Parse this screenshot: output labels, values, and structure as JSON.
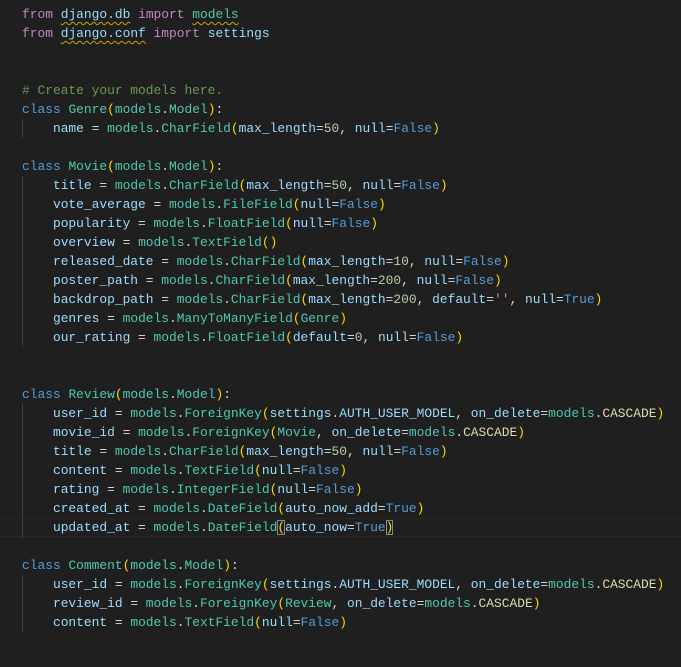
{
  "editor": {
    "language": "python",
    "current_line": 27,
    "colors": {
      "background": "#1f1f1f",
      "keyword": "#c586c0",
      "storage": "#569cd6",
      "class": "#4ec9b0",
      "variable": "#9cdcfe",
      "bracket": "#ffd700",
      "number": "#b5cea8",
      "string": "#ce9178",
      "comment": "#6a9955"
    },
    "lines": [
      [
        [
          "from",
          "kw"
        ],
        [
          " ",
          "p"
        ],
        [
          "django.db",
          "var warn"
        ],
        [
          " ",
          "p"
        ],
        [
          "import",
          "kw"
        ],
        [
          " ",
          "p"
        ],
        [
          "models",
          "mod warn"
        ]
      ],
      [
        [
          "from",
          "kw"
        ],
        [
          " ",
          "p"
        ],
        [
          "django.conf",
          "var warn"
        ],
        [
          " ",
          "p"
        ],
        [
          "import",
          "kw"
        ],
        [
          " ",
          "p"
        ],
        [
          "settings",
          "var"
        ]
      ],
      [],
      [],
      [
        [
          "# Create your models here.",
          "com"
        ]
      ],
      [
        [
          "class",
          "st"
        ],
        [
          " ",
          "p"
        ],
        [
          "Genre",
          "cls"
        ],
        [
          "(",
          "br"
        ],
        [
          "models",
          "mod"
        ],
        [
          ".",
          "p"
        ],
        [
          "Model",
          "cls"
        ],
        [
          ")",
          "br"
        ],
        [
          ":",
          "p"
        ]
      ],
      [
        [
          "    ",
          "p"
        ],
        [
          "name",
          "var"
        ],
        [
          " = ",
          "p"
        ],
        [
          "models",
          "mod"
        ],
        [
          ".",
          "p"
        ],
        [
          "CharField",
          "cls"
        ],
        [
          "(",
          "br"
        ],
        [
          "max_length",
          "var"
        ],
        [
          "=",
          "p"
        ],
        [
          "50",
          "num"
        ],
        [
          ", ",
          "p"
        ],
        [
          "null",
          "var"
        ],
        [
          "=",
          "p"
        ],
        [
          "False",
          "st"
        ],
        [
          ")",
          "br"
        ]
      ],
      [],
      [
        [
          "class",
          "st"
        ],
        [
          " ",
          "p"
        ],
        [
          "Movie",
          "cls"
        ],
        [
          "(",
          "br"
        ],
        [
          "models",
          "mod"
        ],
        [
          ".",
          "p"
        ],
        [
          "Model",
          "cls"
        ],
        [
          ")",
          "br"
        ],
        [
          ":",
          "p"
        ]
      ],
      [
        [
          "    ",
          "p"
        ],
        [
          "title",
          "var"
        ],
        [
          " = ",
          "p"
        ],
        [
          "models",
          "mod"
        ],
        [
          ".",
          "p"
        ],
        [
          "CharField",
          "cls"
        ],
        [
          "(",
          "br"
        ],
        [
          "max_length",
          "var"
        ],
        [
          "=",
          "p"
        ],
        [
          "50",
          "num"
        ],
        [
          ", ",
          "p"
        ],
        [
          "null",
          "var"
        ],
        [
          "=",
          "p"
        ],
        [
          "False",
          "st"
        ],
        [
          ")",
          "br"
        ]
      ],
      [
        [
          "    ",
          "p"
        ],
        [
          "vote_average",
          "var"
        ],
        [
          " = ",
          "p"
        ],
        [
          "models",
          "mod"
        ],
        [
          ".",
          "p"
        ],
        [
          "FileField",
          "cls"
        ],
        [
          "(",
          "br"
        ],
        [
          "null",
          "var"
        ],
        [
          "=",
          "p"
        ],
        [
          "False",
          "st"
        ],
        [
          ")",
          "br"
        ]
      ],
      [
        [
          "    ",
          "p"
        ],
        [
          "popularity",
          "var"
        ],
        [
          " = ",
          "p"
        ],
        [
          "models",
          "mod"
        ],
        [
          ".",
          "p"
        ],
        [
          "FloatField",
          "cls"
        ],
        [
          "(",
          "br"
        ],
        [
          "null",
          "var"
        ],
        [
          "=",
          "p"
        ],
        [
          "False",
          "st"
        ],
        [
          ")",
          "br"
        ]
      ],
      [
        [
          "    ",
          "p"
        ],
        [
          "overview",
          "var"
        ],
        [
          " = ",
          "p"
        ],
        [
          "models",
          "mod"
        ],
        [
          ".",
          "p"
        ],
        [
          "TextField",
          "cls"
        ],
        [
          "()",
          "br"
        ]
      ],
      [
        [
          "    ",
          "p"
        ],
        [
          "released_date",
          "var"
        ],
        [
          " = ",
          "p"
        ],
        [
          "models",
          "mod"
        ],
        [
          ".",
          "p"
        ],
        [
          "CharField",
          "cls"
        ],
        [
          "(",
          "br"
        ],
        [
          "max_length",
          "var"
        ],
        [
          "=",
          "p"
        ],
        [
          "10",
          "num"
        ],
        [
          ", ",
          "p"
        ],
        [
          "null",
          "var"
        ],
        [
          "=",
          "p"
        ],
        [
          "False",
          "st"
        ],
        [
          ")",
          "br"
        ]
      ],
      [
        [
          "    ",
          "p"
        ],
        [
          "poster_path",
          "var"
        ],
        [
          " = ",
          "p"
        ],
        [
          "models",
          "mod"
        ],
        [
          ".",
          "p"
        ],
        [
          "CharField",
          "cls"
        ],
        [
          "(",
          "br"
        ],
        [
          "max_length",
          "var"
        ],
        [
          "=",
          "p"
        ],
        [
          "200",
          "num"
        ],
        [
          ", ",
          "p"
        ],
        [
          "null",
          "var"
        ],
        [
          "=",
          "p"
        ],
        [
          "False",
          "st"
        ],
        [
          ")",
          "br"
        ]
      ],
      [
        [
          "    ",
          "p"
        ],
        [
          "backdrop_path",
          "var"
        ],
        [
          " = ",
          "p"
        ],
        [
          "models",
          "mod"
        ],
        [
          ".",
          "p"
        ],
        [
          "CharField",
          "cls"
        ],
        [
          "(",
          "br"
        ],
        [
          "max_length",
          "var"
        ],
        [
          "=",
          "p"
        ],
        [
          "200",
          "num"
        ],
        [
          ", ",
          "p"
        ],
        [
          "default",
          "var"
        ],
        [
          "=",
          "p"
        ],
        [
          "''",
          "str"
        ],
        [
          ", ",
          "p"
        ],
        [
          "null",
          "var"
        ],
        [
          "=",
          "p"
        ],
        [
          "True",
          "st"
        ],
        [
          ")",
          "br"
        ]
      ],
      [
        [
          "    ",
          "p"
        ],
        [
          "genres",
          "var"
        ],
        [
          " = ",
          "p"
        ],
        [
          "models",
          "mod"
        ],
        [
          ".",
          "p"
        ],
        [
          "ManyToManyField",
          "cls"
        ],
        [
          "(",
          "br"
        ],
        [
          "Genre",
          "cls"
        ],
        [
          ")",
          "br"
        ]
      ],
      [
        [
          "    ",
          "p"
        ],
        [
          "our_rating",
          "var"
        ],
        [
          " = ",
          "p"
        ],
        [
          "models",
          "mod"
        ],
        [
          ".",
          "p"
        ],
        [
          "FloatField",
          "cls"
        ],
        [
          "(",
          "br"
        ],
        [
          "default",
          "var"
        ],
        [
          "=",
          "p"
        ],
        [
          "0",
          "num"
        ],
        [
          ", ",
          "p"
        ],
        [
          "null",
          "var"
        ],
        [
          "=",
          "p"
        ],
        [
          "False",
          "st"
        ],
        [
          ")",
          "br"
        ]
      ],
      [],
      [],
      [
        [
          "class",
          "st"
        ],
        [
          " ",
          "p"
        ],
        [
          "Review",
          "cls"
        ],
        [
          "(",
          "br"
        ],
        [
          "models",
          "mod"
        ],
        [
          ".",
          "p"
        ],
        [
          "Model",
          "cls"
        ],
        [
          ")",
          "br"
        ],
        [
          ":",
          "p"
        ]
      ],
      [
        [
          "    ",
          "p"
        ],
        [
          "user_id",
          "var"
        ],
        [
          " = ",
          "p"
        ],
        [
          "models",
          "mod"
        ],
        [
          ".",
          "p"
        ],
        [
          "ForeignKey",
          "cls"
        ],
        [
          "(",
          "br"
        ],
        [
          "settings",
          "var"
        ],
        [
          ".",
          "p"
        ],
        [
          "AUTH_USER_MODEL",
          "var"
        ],
        [
          ", ",
          "p"
        ],
        [
          "on_delete",
          "var"
        ],
        [
          "=",
          "p"
        ],
        [
          "models",
          "mod"
        ],
        [
          ".",
          "p"
        ],
        [
          "CASCADE",
          "const"
        ],
        [
          ")",
          "br"
        ]
      ],
      [
        [
          "    ",
          "p"
        ],
        [
          "movie_id",
          "var"
        ],
        [
          " = ",
          "p"
        ],
        [
          "models",
          "mod"
        ],
        [
          ".",
          "p"
        ],
        [
          "ForeignKey",
          "cls"
        ],
        [
          "(",
          "br"
        ],
        [
          "Movie",
          "cls"
        ],
        [
          ", ",
          "p"
        ],
        [
          "on_delete",
          "var"
        ],
        [
          "=",
          "p"
        ],
        [
          "models",
          "mod"
        ],
        [
          ".",
          "p"
        ],
        [
          "CASCADE",
          "const"
        ],
        [
          ")",
          "br"
        ]
      ],
      [
        [
          "    ",
          "p"
        ],
        [
          "title",
          "var"
        ],
        [
          " = ",
          "p"
        ],
        [
          "models",
          "mod"
        ],
        [
          ".",
          "p"
        ],
        [
          "CharField",
          "cls"
        ],
        [
          "(",
          "br"
        ],
        [
          "max_length",
          "var"
        ],
        [
          "=",
          "p"
        ],
        [
          "50",
          "num"
        ],
        [
          ", ",
          "p"
        ],
        [
          "null",
          "var"
        ],
        [
          "=",
          "p"
        ],
        [
          "False",
          "st"
        ],
        [
          ")",
          "br"
        ]
      ],
      [
        [
          "    ",
          "p"
        ],
        [
          "content",
          "var"
        ],
        [
          " = ",
          "p"
        ],
        [
          "models",
          "mod"
        ],
        [
          ".",
          "p"
        ],
        [
          "TextField",
          "cls"
        ],
        [
          "(",
          "br"
        ],
        [
          "null",
          "var"
        ],
        [
          "=",
          "p"
        ],
        [
          "False",
          "st"
        ],
        [
          ")",
          "br"
        ]
      ],
      [
        [
          "    ",
          "p"
        ],
        [
          "rating",
          "var"
        ],
        [
          " = ",
          "p"
        ],
        [
          "models",
          "mod"
        ],
        [
          ".",
          "p"
        ],
        [
          "IntegerField",
          "cls"
        ],
        [
          "(",
          "br"
        ],
        [
          "null",
          "var"
        ],
        [
          "=",
          "p"
        ],
        [
          "False",
          "st"
        ],
        [
          ")",
          "br"
        ]
      ],
      [
        [
          "    ",
          "p"
        ],
        [
          "created_at",
          "var"
        ],
        [
          " = ",
          "p"
        ],
        [
          "models",
          "mod"
        ],
        [
          ".",
          "p"
        ],
        [
          "DateField",
          "cls"
        ],
        [
          "(",
          "br"
        ],
        [
          "auto_now_add",
          "var"
        ],
        [
          "=",
          "p"
        ],
        [
          "True",
          "st"
        ],
        [
          ")",
          "br"
        ]
      ],
      [
        [
          "    ",
          "p"
        ],
        [
          "updated_at",
          "var"
        ],
        [
          " = ",
          "p"
        ],
        [
          "models",
          "mod"
        ],
        [
          ".",
          "p"
        ],
        [
          "DateField",
          "cls"
        ],
        [
          "(",
          "br match"
        ],
        [
          "auto_now",
          "var"
        ],
        [
          "=",
          "p"
        ],
        [
          "True",
          "st"
        ],
        [
          ")",
          "br match"
        ]
      ],
      [],
      [
        [
          "class",
          "st"
        ],
        [
          " ",
          "p"
        ],
        [
          "Comment",
          "cls"
        ],
        [
          "(",
          "br"
        ],
        [
          "models",
          "mod"
        ],
        [
          ".",
          "p"
        ],
        [
          "Model",
          "cls"
        ],
        [
          ")",
          "br"
        ],
        [
          ":",
          "p"
        ]
      ],
      [
        [
          "    ",
          "p"
        ],
        [
          "user_id",
          "var"
        ],
        [
          " = ",
          "p"
        ],
        [
          "models",
          "mod"
        ],
        [
          ".",
          "p"
        ],
        [
          "ForeignKey",
          "cls"
        ],
        [
          "(",
          "br"
        ],
        [
          "settings",
          "var"
        ],
        [
          ".",
          "p"
        ],
        [
          "AUTH_USER_MODEL",
          "var"
        ],
        [
          ", ",
          "p"
        ],
        [
          "on_delete",
          "var"
        ],
        [
          "=",
          "p"
        ],
        [
          "models",
          "mod"
        ],
        [
          ".",
          "p"
        ],
        [
          "CASCADE",
          "const"
        ],
        [
          ")",
          "br"
        ]
      ],
      [
        [
          "    ",
          "p"
        ],
        [
          "review_id",
          "var"
        ],
        [
          " = ",
          "p"
        ],
        [
          "models",
          "mod"
        ],
        [
          ".",
          "p"
        ],
        [
          "ForeignKey",
          "cls"
        ],
        [
          "(",
          "br"
        ],
        [
          "Review",
          "cls"
        ],
        [
          ", ",
          "p"
        ],
        [
          "on_delete",
          "var"
        ],
        [
          "=",
          "p"
        ],
        [
          "models",
          "mod"
        ],
        [
          ".",
          "p"
        ],
        [
          "CASCADE",
          "const"
        ],
        [
          ")",
          "br"
        ]
      ],
      [
        [
          "    ",
          "p"
        ],
        [
          "content",
          "var"
        ],
        [
          " = ",
          "p"
        ],
        [
          "models",
          "mod"
        ],
        [
          ".",
          "p"
        ],
        [
          "TextField",
          "cls"
        ],
        [
          "(",
          "br"
        ],
        [
          "null",
          "var"
        ],
        [
          "=",
          "p"
        ],
        [
          "False",
          "st"
        ],
        [
          ")",
          "br"
        ]
      ]
    ]
  }
}
